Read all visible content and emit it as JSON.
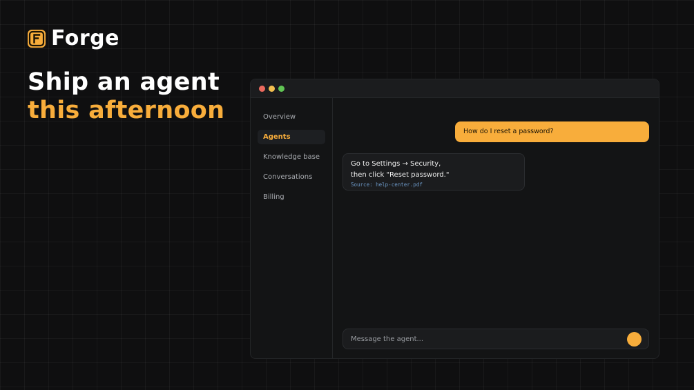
{
  "brand": {
    "logo_letter": "F",
    "name": "Forge"
  },
  "headline": {
    "line1": "Ship an agent",
    "line2": "this afternoon"
  },
  "window": {
    "traffic_lights": [
      "#ec6a5e",
      "#f4bf4f",
      "#61c554"
    ],
    "sidebar": {
      "items": [
        {
          "label": "Overview",
          "active": false
        },
        {
          "label": "Agents",
          "active": true
        },
        {
          "label": "Knowledge base",
          "active": false
        },
        {
          "label": "Conversations",
          "active": false
        },
        {
          "label": "Billing",
          "active": false
        }
      ]
    },
    "chat": {
      "user_message": "How do I reset a password?",
      "agent_message": {
        "line1": "Go to Settings → Security,",
        "line2": "then click \"Reset password.\"",
        "source": "Source: help-center.pdf"
      },
      "composer": {
        "placeholder": "Message the agent...",
        "send_icon": "send-icon"
      }
    }
  },
  "colors": {
    "accent": "#f8ad3b",
    "background": "#0f0f10",
    "source_link": "#6c98c7"
  }
}
